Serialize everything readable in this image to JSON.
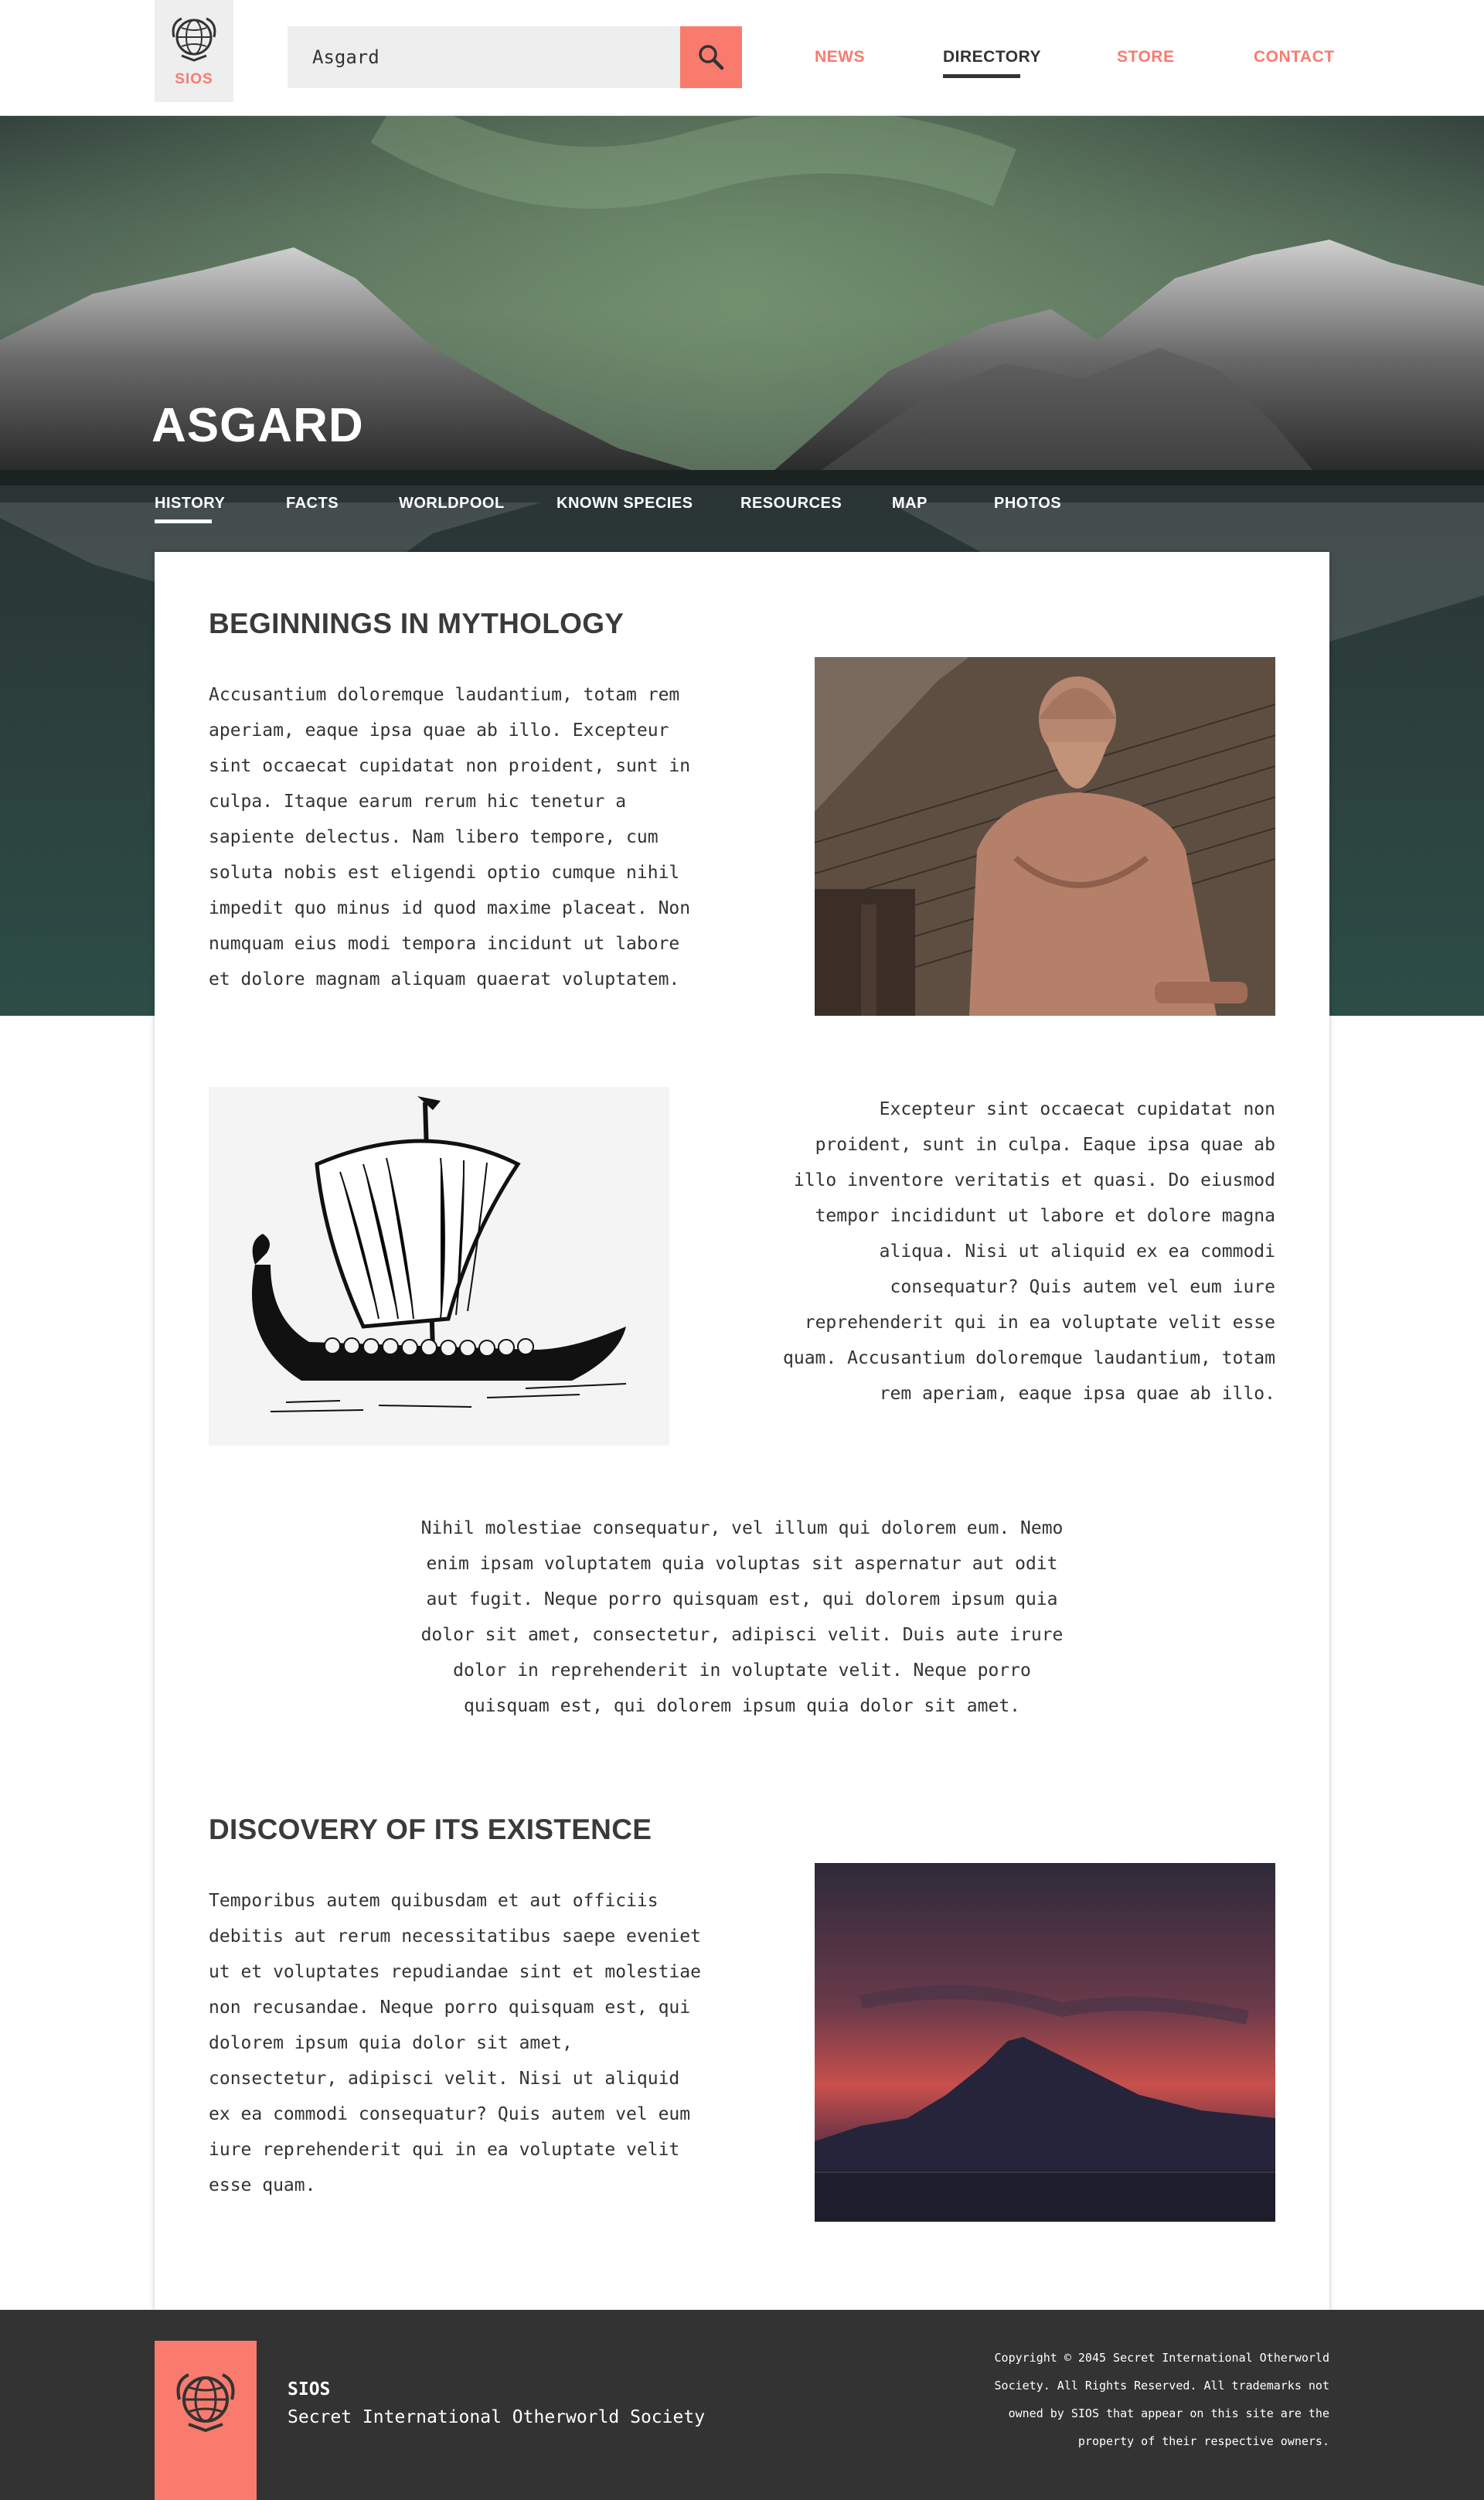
{
  "header": {
    "logo_text": "SIOS",
    "search": {
      "value": "Asgard",
      "placeholder": ""
    },
    "nav": [
      {
        "label": "NEWS",
        "active": false
      },
      {
        "label": "DIRECTORY",
        "active": true
      },
      {
        "label": "STORE",
        "active": false
      },
      {
        "label": "CONTACT",
        "active": false
      }
    ]
  },
  "hero": {
    "title": "ASGARD",
    "tabs": [
      {
        "label": "HISTORY",
        "active": true
      },
      {
        "label": "FACTS",
        "active": false
      },
      {
        "label": "WORLDPOOL",
        "active": false
      },
      {
        "label": "KNOWN SPECIES",
        "active": false
      },
      {
        "label": "RESOURCES",
        "active": false
      },
      {
        "label": "MAP",
        "active": false
      },
      {
        "label": "PHOTOS",
        "active": false
      }
    ]
  },
  "content": {
    "section1": {
      "heading": "BEGINNINGS IN MYTHOLOGY",
      "lines": [
        "Accusantium doloremque laudantium, totam rem",
        "aperiam, eaque ipsa quae ab illo. Excepteur",
        "sint occaecat cupidatat non proident, sunt in",
        "culpa. Itaque earum rerum hic tenetur a",
        "sapiente delectus. Nam libero tempore, cum",
        "soluta nobis est eligendi optio cumque nihil",
        "impedit quo minus id quod maxime placeat. Non",
        "numquam eius modi tempora incidunt ut labore",
        "et dolore magnam aliquam quaerat voluptatem."
      ]
    },
    "section2": {
      "lines": [
        "Excepteur sint occaecat cupidatat non",
        "proident, sunt in culpa. Eaque ipsa quae ab",
        "illo inventore veritatis et quasi. Do eiusmod",
        "tempor incididunt ut labore et dolore magna",
        "aliqua. Nisi ut aliquid ex ea commodi",
        "consequatur? Quis autem vel eum iure",
        "reprehenderit qui in ea voluptate velit esse",
        "quam. Accusantium doloremque laudantium, totam",
        "rem aperiam, eaque ipsa quae ab illo."
      ]
    },
    "section3": {
      "lines": [
        "Nihil molestiae consequatur, vel illum qui dolorem eum. Nemo",
        "enim ipsam voluptatem quia voluptas sit aspernatur aut odit",
        "aut fugit. Neque porro quisquam est, qui dolorem ipsum quia",
        "dolor sit amet, consectetur, adipisci velit. Duis aute irure",
        "dolor in reprehenderit in voluptate velit. Neque porro",
        "quisquam est, qui dolorem ipsum quia dolor sit amet."
      ]
    },
    "section4": {
      "heading": "DISCOVERY OF ITS EXISTENCE",
      "lines": [
        "Temporibus autem quibusdam et aut officiis",
        "debitis aut rerum necessitatibus saepe eveniet",
        "ut et voluptates repudiandae sint et molestiae",
        "non recusandae. Neque porro quisquam est, qui",
        "dolorem ipsum quia dolor sit amet,",
        "consectetur, adipisci velit. Nisi ut aliquid",
        "ex ea commodi consequatur? Quis autem vel eum",
        "iure reprehenderit qui in ea voluptate velit",
        "esse quam."
      ]
    }
  },
  "footer": {
    "name": "SIOS",
    "full_name": "Secret International Otherworld Society",
    "copyright_lines": [
      "Copyright © 2045 Secret International Otherworld",
      "Society. All Rights Reserved. All trademarks not",
      "owned by SIOS that appear on this site are the",
      "property of their respective owners."
    ]
  },
  "colors": {
    "accent": "#f97b6e",
    "dark": "#333333",
    "light_gray": "#eeeeee"
  },
  "icons": [
    "globe-logo-icon",
    "search-icon"
  ]
}
